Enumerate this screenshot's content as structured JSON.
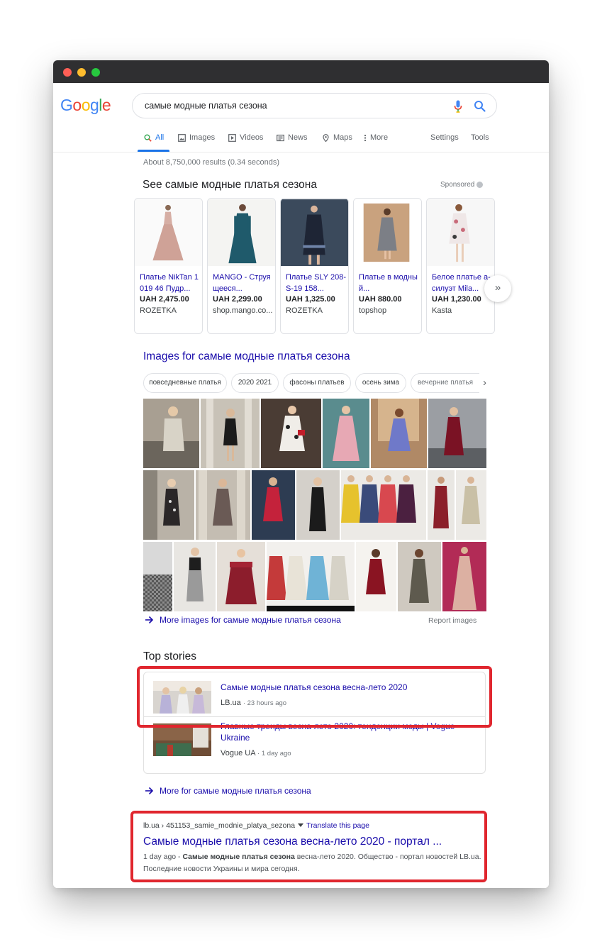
{
  "logo": "Google",
  "search": {
    "query": "самые модные платья сезона"
  },
  "tabs": [
    {
      "label": "All"
    },
    {
      "label": "Images"
    },
    {
      "label": "Videos"
    },
    {
      "label": "News"
    },
    {
      "label": "Maps"
    },
    {
      "label": "More"
    },
    {
      "label": "Settings"
    },
    {
      "label": "Tools"
    }
  ],
  "result_stats": "About 8,750,000 results (0.34 seconds)",
  "shopping": {
    "title": "See самые модные платья сезона",
    "sponsored": "Sponsored",
    "products": [
      {
        "title": "Платье NikTan 1019 46 Пудр...",
        "price": "UAH 2,475.00",
        "store": "ROZETKA"
      },
      {
        "title": "MANGO - Струящееся...",
        "price": "UAH 2,299.00",
        "store": "shop.mango.co..."
      },
      {
        "title": "Платье SLY 208-S-19 158...",
        "price": "UAH 1,325.00",
        "store": "ROZETKA"
      },
      {
        "title": "Платье в модный...",
        "price": "UAH 880.00",
        "store": "topshop"
      },
      {
        "title": "Белое платье а-силуэт Mila...",
        "price": "UAH 1,230.00",
        "store": "Kasta"
      }
    ],
    "next": "»"
  },
  "images": {
    "title": "Images for самые модные платья сезона",
    "chips": [
      "повседневные платья",
      "2020 2021",
      "фасоны платьев",
      "осень зима",
      "вечерние платья"
    ],
    "chip_next": "›",
    "more": "More images for самые модные платья сезона",
    "report": "Report images"
  },
  "top_stories": {
    "title": "Top stories",
    "items": [
      {
        "headline": "Самые модные платья сезона весна-лето 2020",
        "source": "LB.ua",
        "ago": "23 hours ago"
      },
      {
        "headline": "Главные тренды весна-лето 2020: тенденции моды | Vogue Ukraine",
        "source": "Vogue UA",
        "ago": "1 day ago"
      }
    ],
    "more": "More for самые модные платья сезона"
  },
  "result": {
    "url": "lb.ua › 451153_samie_modnie_platya_sezona",
    "translate": "Translate this page",
    "title": "Самые модные платья сезона весна-лето 2020 - портал ...",
    "date": "1 day ago - ",
    "snippet_bold": "Самые модные платья сезона",
    "snippet_rest": " весна-лето 2020. Общество - портал новостей LB.ua. Последние новости Украины и мира сегодня."
  },
  "icons": {
    "search": "search-icon",
    "mic": "mic-icon",
    "arrow": "arrow-right-icon"
  },
  "colors": {
    "link": "#1a0dab",
    "accent": "#1a73e8",
    "highlight": "#e0262e",
    "titlebar": "#2f2f31"
  }
}
